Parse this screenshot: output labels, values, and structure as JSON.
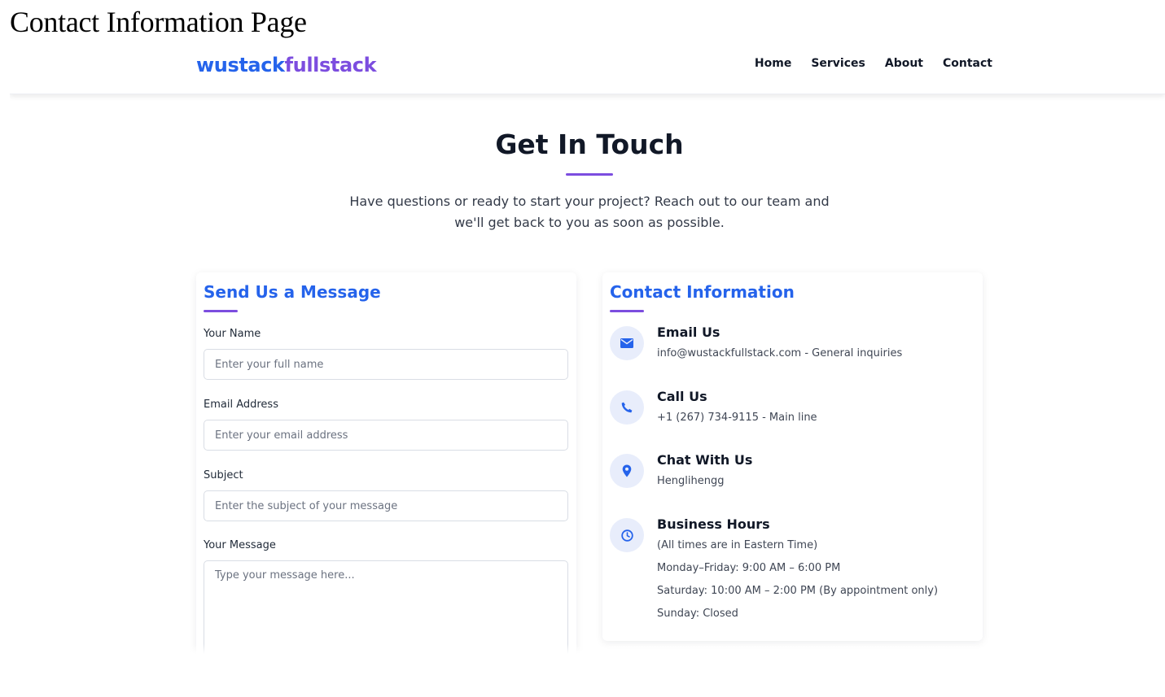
{
  "caption": "Contact Information Page",
  "nav": {
    "logo_part1": "wustack",
    "logo_part2": "fullstack",
    "links": [
      "Home",
      "Services",
      "About",
      "Contact"
    ]
  },
  "hero": {
    "title": "Get In Touch",
    "subtitle": "Have questions or ready to start your project? Reach out to our team and we'll get back to you as soon as possible."
  },
  "form": {
    "title": "Send Us a Message",
    "name_label": "Your Name",
    "name_placeholder": "Enter your full name",
    "email_label": "Email Address",
    "email_placeholder": "Enter your email address",
    "subject_label": "Subject",
    "subject_placeholder": "Enter the subject of your message",
    "message_label": "Your Message",
    "message_placeholder": "Type your message here..."
  },
  "info": {
    "title": "Contact Information",
    "email_heading": "Email Us",
    "email_text": "info@wustackfullstack.com - General inquiries",
    "phone_heading": "Call Us",
    "phone_text": "+1 (267) 734-9115 - Main line",
    "chat_heading": "Chat With Us",
    "chat_text": "Henglihengg",
    "hours_heading": "Business Hours",
    "hours_lines": [
      "(All times are in Eastern Time)",
      "Monday–Friday: 9:00 AM – 6:00 PM",
      "Saturday: 10:00 AM – 2:00 PM (By appointment only)",
      "Sunday: Closed"
    ]
  },
  "colors": {
    "brand_blue": "#2563eb",
    "brand_purple": "#7c4ddf",
    "icon_bg": "#e8edfb"
  },
  "icons": [
    "envelope-icon",
    "phone-icon",
    "location-pin-icon",
    "clock-icon"
  ]
}
